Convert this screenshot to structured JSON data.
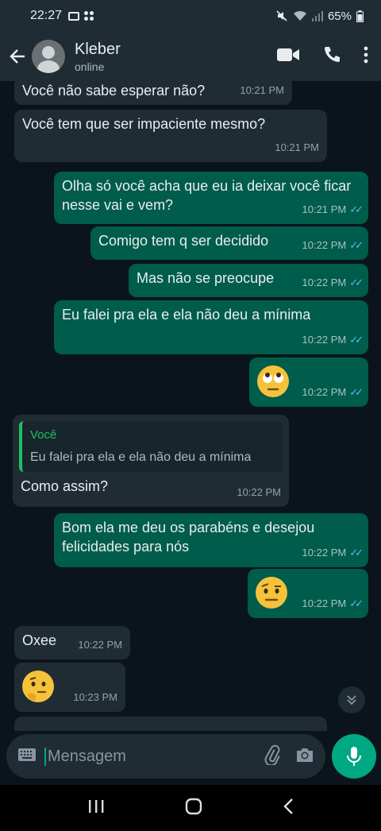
{
  "status_bar": {
    "time": "22:27",
    "battery": "65%"
  },
  "header": {
    "contact_name": "Kleber",
    "contact_status": "online"
  },
  "messages": [
    {
      "dir": "in",
      "text": "Você não sabe esperar não?",
      "time": "10:21 PM"
    },
    {
      "dir": "in",
      "text": "Você tem que ser impaciente mesmo?",
      "time": "10:21 PM"
    },
    {
      "dir": "out",
      "text": "Olha só você acha que eu ia deixar você ficar nesse vai e vem?",
      "time": "10:21 PM"
    },
    {
      "dir": "out",
      "text": "Comigo tem q ser decidido",
      "time": "10:22 PM"
    },
    {
      "dir": "out",
      "text": "Mas não se preocupe",
      "time": "10:22 PM"
    },
    {
      "dir": "out",
      "text": "Eu falei pra ela e ela não deu a mínima",
      "time": "10:22 PM"
    },
    {
      "dir": "out",
      "emoji": "face-with-rolling-eyes",
      "time": "10:22 PM"
    },
    {
      "dir": "in",
      "quote_name": "Você",
      "quote_text": "Eu falei pra ela e ela não deu a mínima",
      "text": "Como assim?",
      "time": "10:22 PM"
    },
    {
      "dir": "out",
      "text": "Bom ela me deu os parabéns e desejou felicidades para nós",
      "time": "10:22 PM"
    },
    {
      "dir": "out",
      "emoji": "face-with-raised-eyebrow",
      "time": "10:22 PM"
    },
    {
      "dir": "in",
      "text": "Oxee",
      "time": "10:22 PM"
    },
    {
      "dir": "in",
      "emoji": "thinking-face",
      "time": "10:23 PM"
    }
  ],
  "input": {
    "placeholder": "Mensagem"
  },
  "colors": {
    "accent": "#00a884",
    "outgoing": "#005c4b",
    "incoming": "#1f2c34",
    "read_ticks": "#53bdeb"
  }
}
